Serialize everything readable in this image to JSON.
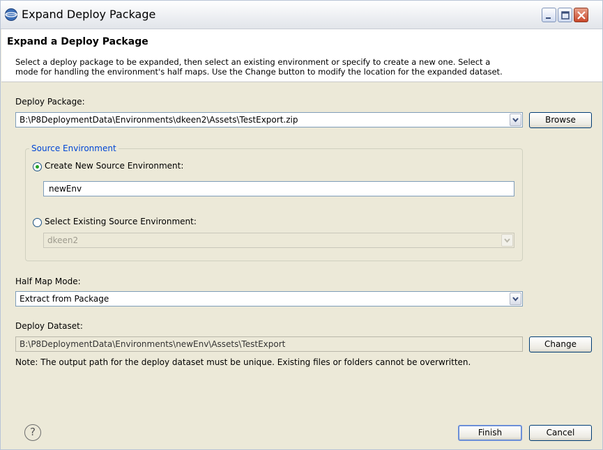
{
  "window": {
    "title": "Expand Deploy Package"
  },
  "header": {
    "title": "Expand a Deploy Package",
    "description_line1": "Select a deploy package to be expanded, then select an existing environment or specify to create a new one.  Select a",
    "description_line2": "mode for handling the environment's half maps.  Use the Change button to modify the location for the expanded dataset."
  },
  "deploy_package": {
    "label": "Deploy Package:",
    "value": "B:\\P8DeploymentData\\Environments\\dkeen2\\Assets\\TestExport.zip",
    "browse_label": "Browse"
  },
  "source_environment": {
    "legend": "Source Environment",
    "create_new_label": "Create New Source Environment:",
    "create_new_selected": true,
    "new_env_value": "newEnv",
    "select_existing_label": "Select Existing Source Environment:",
    "existing_value": "dkeen2"
  },
  "half_map_mode": {
    "label": "Half Map Mode:",
    "value": "Extract from Package"
  },
  "deploy_dataset": {
    "label": "Deploy Dataset:",
    "value": "B:\\P8DeploymentData\\Environments\\newEnv\\Assets\\TestExport",
    "change_label": "Change",
    "note": "Note: The output path for the deploy dataset must be unique.  Existing files or folders cannot be overwritten."
  },
  "footer": {
    "help_symbol": "?",
    "finish_label": "Finish",
    "cancel_label": "Cancel"
  },
  "colors": {
    "accent_blue": "#0046d5",
    "radio_green": "#21a121"
  }
}
